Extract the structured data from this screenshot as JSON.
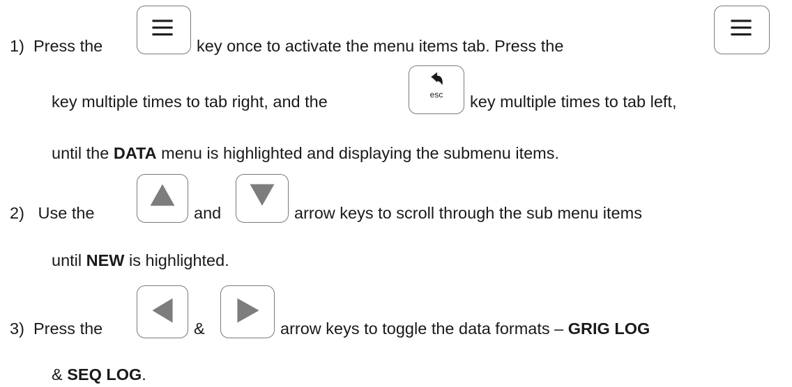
{
  "step1": {
    "number": "1)",
    "text_a": "Press the",
    "text_b": "key once to activate the menu items tab.  Press the",
    "text_c": "key multiple times to tab right, and the",
    "text_d": "key multiple times to tab left,",
    "text_e_pre": "until the",
    "text_e_bold": "DATA",
    "text_e_post": "menu is highlighted and displaying the submenu items.",
    "menu_key_icon": "menu-key-icon",
    "esc_key_label": "esc",
    "esc_key_icon": "esc-back-key-icon"
  },
  "step2": {
    "number": "2)",
    "text_a": "Use the",
    "text_b": "and",
    "text_c": "arrow keys to scroll through the sub menu items",
    "text_d_pre": "until",
    "text_d_bold": "NEW",
    "text_d_post": "is highlighted.",
    "up_key_icon": "up-arrow-key-icon",
    "down_key_icon": "down-arrow-key-icon"
  },
  "step3": {
    "number": "3)",
    "text_a": "Press the",
    "text_b": "&",
    "text_c": "arrow keys to toggle the data formats –",
    "text_c_bold": "GRIG LOG",
    "text_d_pre": "&",
    "text_d_bold": "SEQ LOG",
    "text_d_post": ".",
    "left_key_icon": "left-arrow-key-icon",
    "right_key_icon": "right-arrow-key-icon"
  },
  "colors": {
    "text": "#1a1a1a",
    "key_border": "#7a7a7a",
    "key_glyph": "#7d7d7d"
  }
}
